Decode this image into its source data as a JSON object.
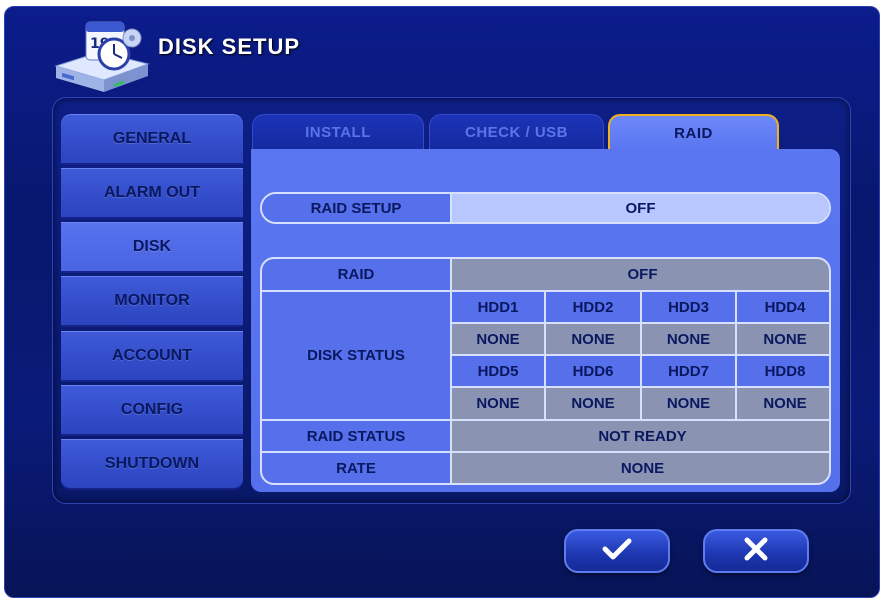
{
  "window": {
    "title": "DISK SETUP"
  },
  "sidebar": {
    "items": [
      {
        "label": "GENERAL"
      },
      {
        "label": "ALARM OUT"
      },
      {
        "label": "DISK",
        "active": true
      },
      {
        "label": "MONITOR"
      },
      {
        "label": "ACCOUNT"
      },
      {
        "label": "CONFIG"
      },
      {
        "label": "SHUTDOWN"
      }
    ]
  },
  "tabs": [
    {
      "label": "INSTALL"
    },
    {
      "label": "CHECK / USB"
    },
    {
      "label": "RAID",
      "active": true
    }
  ],
  "raid_setup": {
    "label": "RAID SETUP",
    "value": "OFF"
  },
  "status_table": {
    "raid_label": "RAID",
    "raid_value": "OFF",
    "disk_status_label": "DISK STATUS",
    "disks_row1": [
      "HDD1",
      "HDD2",
      "HDD3",
      "HDD4"
    ],
    "status_row1": [
      "NONE",
      "NONE",
      "NONE",
      "NONE"
    ],
    "disks_row2": [
      "HDD5",
      "HDD6",
      "HDD7",
      "HDD8"
    ],
    "status_row2": [
      "NONE",
      "NONE",
      "NONE",
      "NONE"
    ],
    "raid_status_label": "RAID STATUS",
    "raid_status_value": "NOT READY",
    "rate_label": "RATE",
    "rate_value": "NONE"
  },
  "actions": {
    "confirm_icon": "checkmark-icon",
    "cancel_icon": "x-icon"
  },
  "colors": {
    "accent": "#f0b020",
    "panel": "#5a76f0",
    "background": "#0b1c8c"
  }
}
